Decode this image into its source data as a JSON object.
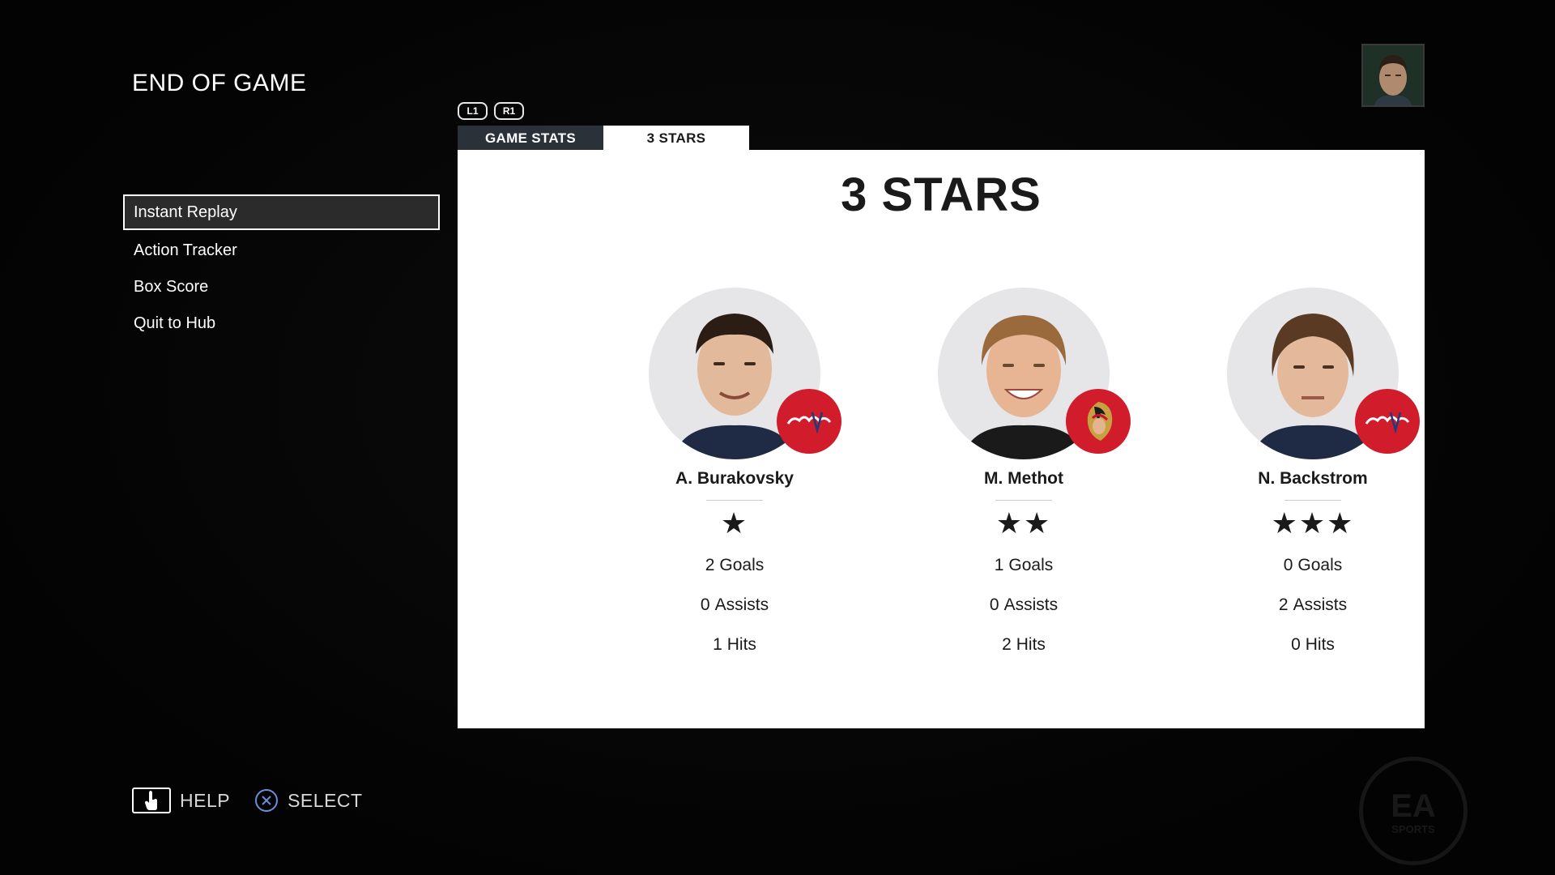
{
  "page": {
    "title": "END OF GAME"
  },
  "menu": {
    "items": [
      {
        "label": "Instant Replay",
        "selected": true
      },
      {
        "label": "Action Tracker",
        "selected": false
      },
      {
        "label": "Box Score",
        "selected": false
      },
      {
        "label": "Quit to Hub",
        "selected": false
      }
    ]
  },
  "tab_bumpers": {
    "left": "L1",
    "right": "R1"
  },
  "tabs": [
    {
      "label": "GAME STATS",
      "active": false
    },
    {
      "label": "3 STARS",
      "active": true
    }
  ],
  "panel": {
    "title": "3 STARS",
    "players": [
      {
        "name": "A. Burakovsky",
        "team_logo": "capitals-logo",
        "stars": 1,
        "stars_text": "★",
        "goals": "2",
        "goals_label": "Goals",
        "assists": "0",
        "assists_label": "Assists",
        "hits": "1",
        "hits_label": "Hits"
      },
      {
        "name": "M. Methot",
        "team_logo": "senators-logo",
        "stars": 2,
        "stars_text": "★★",
        "goals": "1",
        "goals_label": "Goals",
        "assists": "0",
        "assists_label": "Assists",
        "hits": "2",
        "hits_label": "Hits"
      },
      {
        "name": "N. Backstrom",
        "team_logo": "capitals-logo",
        "stars": 3,
        "stars_text": "★★★",
        "goals": "0",
        "goals_label": "Goals",
        "assists": "2",
        "assists_label": "Assists",
        "hits": "0",
        "hits_label": "Hits"
      }
    ]
  },
  "footer": {
    "help_label": "HELP",
    "select_label": "SELECT"
  },
  "colors": {
    "background": "#050505",
    "panel": "#ffffff",
    "tab_inactive": "#2a3139",
    "team_red": "#d01c2b",
    "text_dark": "#1a1a1a"
  }
}
